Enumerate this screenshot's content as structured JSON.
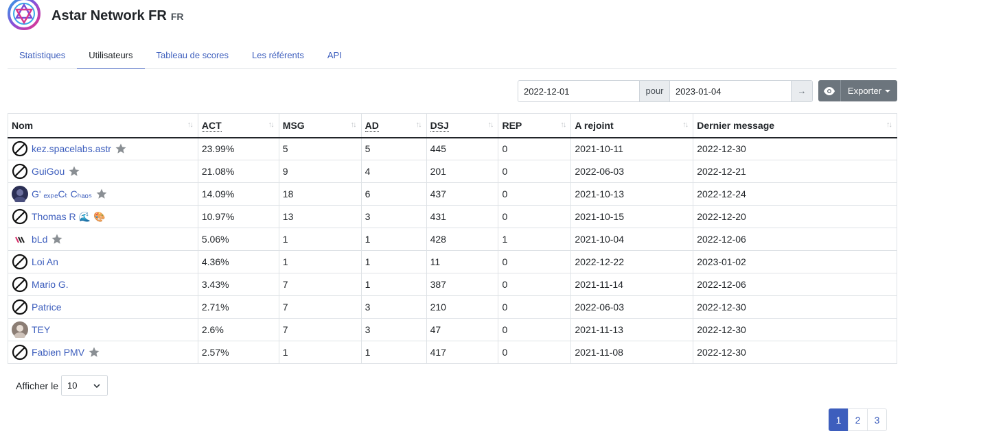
{
  "header": {
    "title": "Astar Network FR",
    "tag": "FR"
  },
  "tabs": [
    {
      "label": "Statistiques"
    },
    {
      "label": "Utilisateurs"
    },
    {
      "label": "Tableau de scores"
    },
    {
      "label": "Les référents"
    },
    {
      "label": "API"
    }
  ],
  "filter": {
    "date_from": "2022-12-01",
    "separator": "pour",
    "date_to": "2023-01-04",
    "go": "→",
    "export_label": "Exporter"
  },
  "table": {
    "headers": [
      "Nom",
      "ACT",
      "MSG",
      "AD",
      "DSJ",
      "REP",
      "A rejoint",
      "Dernier message"
    ],
    "rows": [
      {
        "name": "kez.spacelabs.astr",
        "act": "23.99%",
        "msg": "5",
        "ad": "5",
        "dsj": "445",
        "rep": "0",
        "joined": "2021-10-11",
        "last": "2022-12-30"
      },
      {
        "name": "GuiGou",
        "act": "21.08%",
        "msg": "9",
        "ad": "4",
        "dsj": "201",
        "rep": "0",
        "joined": "2022-06-03",
        "last": "2022-12-21"
      },
      {
        "name": "G' ₑₓₚₑCₜ Cₕₐₒₛ",
        "act": "14.09%",
        "msg": "18",
        "ad": "6",
        "dsj": "437",
        "rep": "0",
        "joined": "2021-10-13",
        "last": "2022-12-24"
      },
      {
        "name": "Thomas R",
        "act": "10.97%",
        "msg": "13",
        "ad": "3",
        "dsj": "431",
        "rep": "0",
        "joined": "2021-10-15",
        "last": "2022-12-20"
      },
      {
        "name": "bLd",
        "act": "5.06%",
        "msg": "1",
        "ad": "1",
        "dsj": "428",
        "rep": "1",
        "joined": "2021-10-04",
        "last": "2022-12-06"
      },
      {
        "name": "Loi An",
        "act": "4.36%",
        "msg": "1",
        "ad": "1",
        "dsj": "11",
        "rep": "0",
        "joined": "2022-12-22",
        "last": "2023-01-02"
      },
      {
        "name": "Mario G.",
        "act": "3.43%",
        "msg": "7",
        "ad": "1",
        "dsj": "387",
        "rep": "0",
        "joined": "2021-11-14",
        "last": "2022-12-06"
      },
      {
        "name": "Patrice",
        "act": "2.71%",
        "msg": "7",
        "ad": "3",
        "dsj": "210",
        "rep": "0",
        "joined": "2022-06-03",
        "last": "2022-12-30"
      },
      {
        "name": "TEY",
        "act": "2.6%",
        "msg": "7",
        "ad": "3",
        "dsj": "47",
        "rep": "0",
        "joined": "2021-11-13",
        "last": "2022-12-30"
      },
      {
        "name": "Fabien PMV",
        "act": "2.57%",
        "msg": "1",
        "ad": "1",
        "dsj": "417",
        "rep": "0",
        "joined": "2021-11-08",
        "last": "2022-12-30"
      }
    ]
  },
  "length": {
    "label": "Afficher le",
    "value": "10"
  },
  "pagination": [
    "1",
    "2",
    "3"
  ],
  "colors": {
    "link": "#3d5ebd",
    "button": "#6c757d",
    "star": "#8a8f94"
  }
}
